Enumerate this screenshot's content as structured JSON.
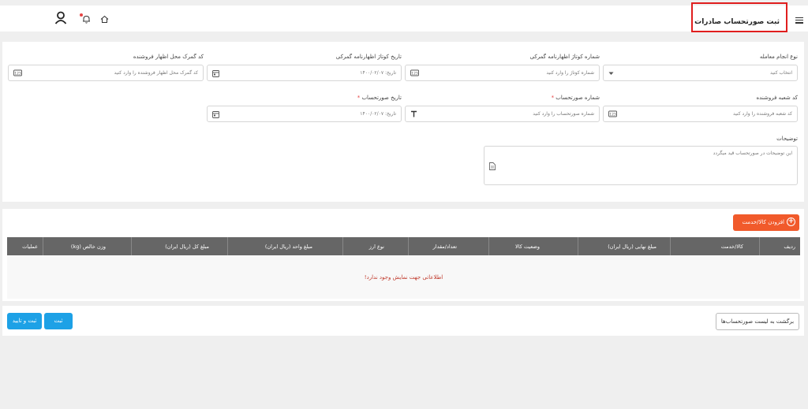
{
  "header": {
    "title": "ثبت صورتحساب صادرات",
    "icons": [
      "menu-icon",
      "user-icon",
      "bell-icon",
      "home-icon"
    ]
  },
  "form": {
    "transaction_type": {
      "label": "نوع انجام معامله",
      "placeholder": "انتخاب کنید"
    },
    "customs_declaration_no": {
      "label": "شماره کوتاژ اظهارنامه گمرکی",
      "placeholder": "شماره کوتاژ را وارد کنید"
    },
    "customs_declaration_date": {
      "label": "تاریخ کوتاژ اظهارنامه گمرکی",
      "placeholder": "تاریخ: ۱۴۰۰/۰۲/۰۷"
    },
    "seller_customs_code": {
      "label": "کد گمرک محل اظهار فروشنده",
      "placeholder": "کد گمرک محل اظهار فروشنده را وارد کنید"
    },
    "seller_branch_code": {
      "label": "کد شعبه فروشنده",
      "placeholder": "کد شعبه فروشنده را وارد کنید"
    },
    "invoice_no": {
      "label": "شماره صورتحساب",
      "required": "*",
      "placeholder": "شماره صورتحساب را وارد کنید"
    },
    "invoice_date": {
      "label": "تاریخ صورتحساب",
      "required": "*",
      "placeholder": "تاریخ: ۱۴۰۰/۰۲/۰۷"
    },
    "description": {
      "label": "توضیحات",
      "placeholder": "این توضیحات در صورتحساب قید میگردد"
    }
  },
  "items": {
    "add_button": "افزودن کالا/خدمت",
    "columns": [
      "ردیف",
      "کالا/خدمت",
      "مبلغ نهایی (ریال ایران)",
      "وضعیت کالا",
      "تعداد/مقدار",
      "نوع ارز",
      "مبلغ واحد (ریال ایران)",
      "مبلغ کل (ریال ایران)",
      "وزن خالص (kg)",
      "عملیات"
    ],
    "empty_message": "اطلاعاتی جهت نمایش وجود ندارد!"
  },
  "footer": {
    "back_button": "برگشت به لیست صورتحساب‌ها",
    "submit_button": "ثبت",
    "submit_confirm_button": "ثبت و تایید"
  },
  "colors": {
    "accent_orange": "#f15a2b",
    "accent_blue": "#1da1e6",
    "table_header": "#666666",
    "highlight_border": "#e01e1e",
    "error_text": "#c0392b"
  }
}
